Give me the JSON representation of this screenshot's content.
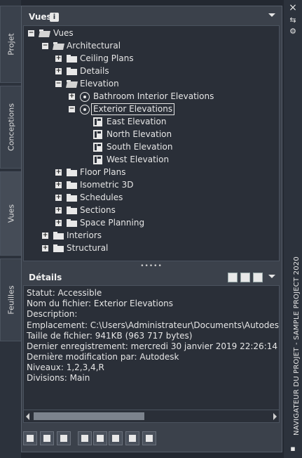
{
  "left_tabs": [
    {
      "label": "Projet",
      "active": false
    },
    {
      "label": "Conceptions",
      "active": false
    },
    {
      "label": "Vues",
      "active": true
    },
    {
      "label": "Feuilles",
      "active": false
    }
  ],
  "panel": {
    "title": "Vues",
    "info_icon": "i"
  },
  "tree": {
    "root": "Vues",
    "architectural": "Architectural",
    "ceiling_plans": "Ceiling Plans",
    "details": "Details",
    "elevation": "Elevation",
    "bathroom_interior_elevations": "Bathroom Interior Elevations",
    "exterior_elevations": "Exterior Elevations",
    "east_elevation": "East Elevation",
    "north_elevation": "North Elevation",
    "south_elevation": "South Elevation",
    "west_elevation": "West Elevation",
    "floor_plans": "Floor Plans",
    "isometric_3d": "Isometric 3D",
    "schedules": "Schedules",
    "sections": "Sections",
    "space_planning": "Space Planning",
    "interiors": "Interiors",
    "structural": "Structural"
  },
  "splitter": "•••••",
  "details": {
    "title": "Détails",
    "rows": [
      "Statut: Accessible",
      "Nom du fichier: Exterior Elevations",
      "Description:",
      "Emplacement: C:\\Users\\Administrateur\\Documents\\Autodesk\\Mes p",
      "Taille de fichier: 941KB (963 717 bytes)",
      "Dernier enregistrement: mercredi 30 janvier 2019  22:26:14",
      "Dernière modification par: Autodesk",
      "Niveaux: 1,2,3,4,R",
      "Divisions: Main"
    ]
  },
  "right_bar": {
    "title": "NAVIGATEUR DU PROJET - SAMPLE PROJECT 2020",
    "close": "×",
    "autohide": "⇆",
    "settings": "⚙"
  }
}
